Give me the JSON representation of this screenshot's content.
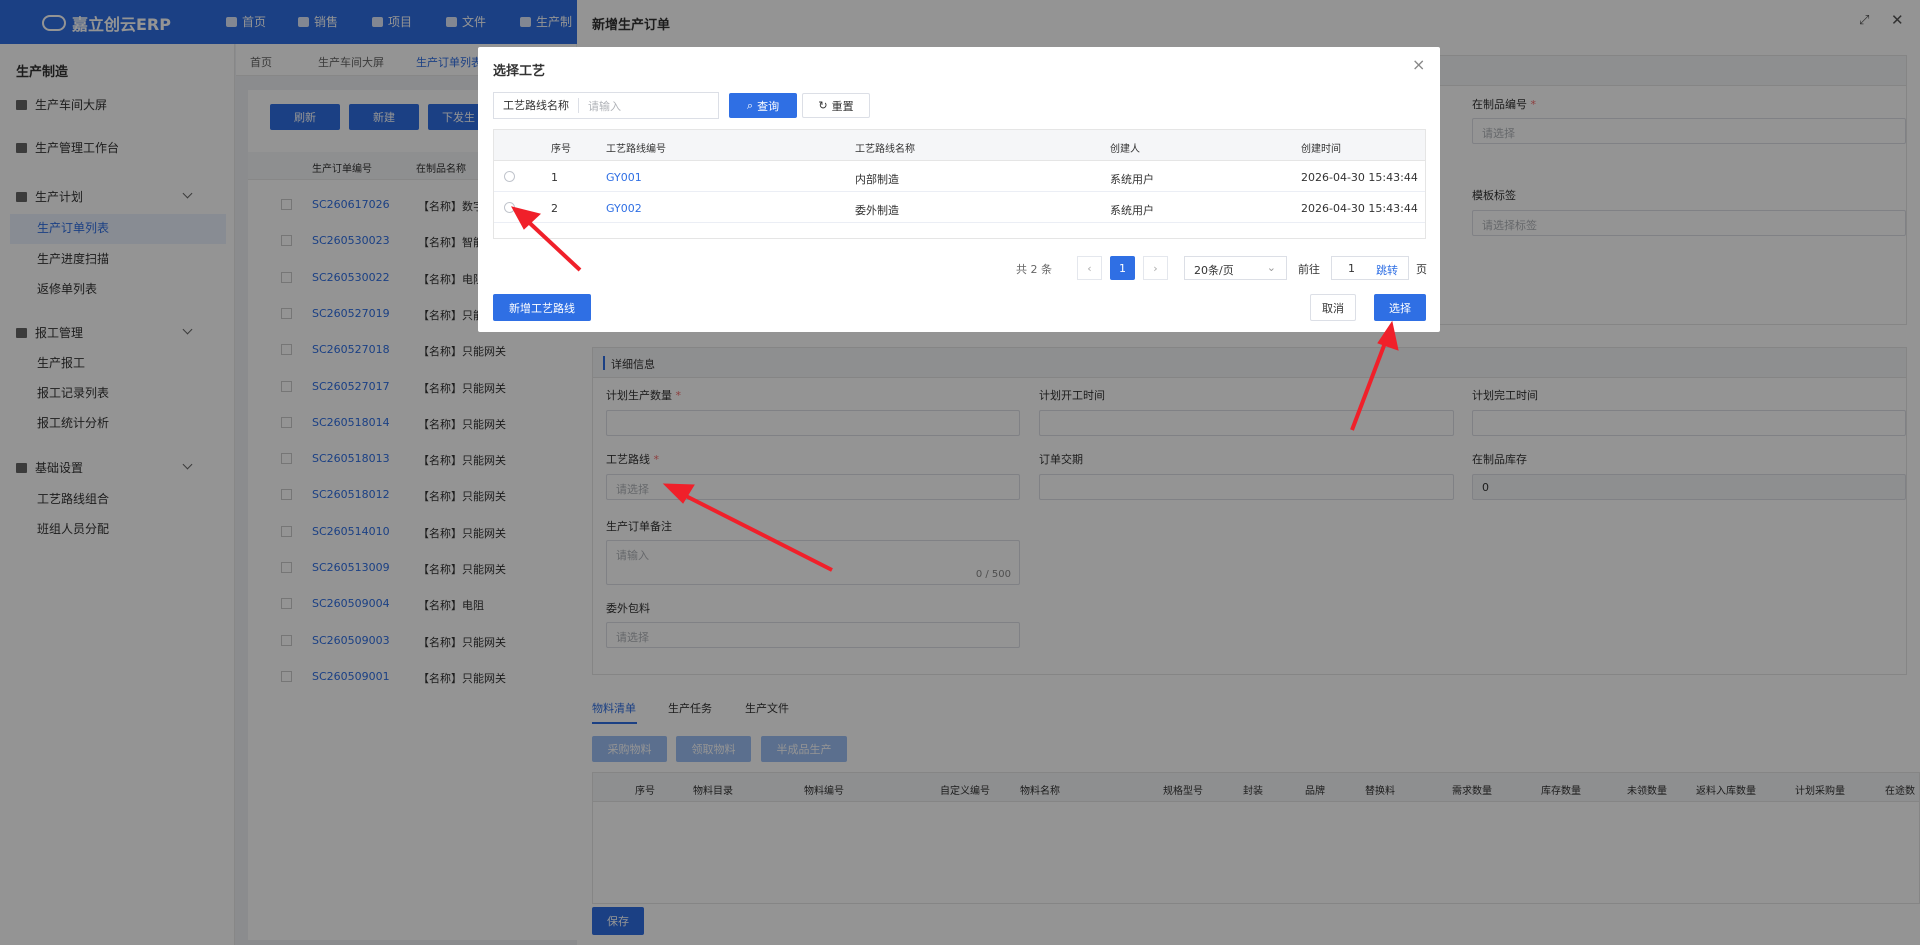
{
  "topbar": {
    "logo": "嘉立创云ERP",
    "nav": [
      "首页",
      "销售",
      "项目",
      "文件",
      "生产制"
    ]
  },
  "sidebar": {
    "title": "生产制造",
    "items": [
      {
        "label": "生产车间大屏"
      },
      {
        "label": "生产管理工作台"
      },
      {
        "label": "生产计划",
        "children": [
          "生产订单列表",
          "生产进度扫描",
          "返修单列表"
        ]
      },
      {
        "label": "报工管理",
        "children": [
          "生产报工",
          "报工记录列表",
          "报工统计分析"
        ]
      },
      {
        "label": "基础设置",
        "children": [
          "工艺路线组合",
          "班组人员分配"
        ]
      }
    ]
  },
  "breadcrumb": [
    "首页",
    "生产车间大屏",
    "生产订单列表"
  ],
  "list": {
    "buttons": {
      "refresh": "刷新",
      "new": "新建",
      "issue": "下发生"
    },
    "columns": [
      "生产订单编号",
      "在制品名称"
    ],
    "rows": [
      {
        "code": "SC260617026",
        "name": "【名称】数字"
      },
      {
        "code": "SC260530023",
        "name": "【名称】智能"
      },
      {
        "code": "SC260530022",
        "name": "【名称】电阻"
      },
      {
        "code": "SC260527019",
        "name": "【名称】只能"
      },
      {
        "code": "SC260527018",
        "name": "【名称】只能网关"
      },
      {
        "code": "SC260527017",
        "name": "【名称】只能网关"
      },
      {
        "code": "SC260518014",
        "name": "【名称】只能网关"
      },
      {
        "code": "SC260518013",
        "name": "【名称】只能网关"
      },
      {
        "code": "SC260518012",
        "name": "【名称】只能网关"
      },
      {
        "code": "SC260514010",
        "name": "【名称】只能网关"
      },
      {
        "code": "SC260513009",
        "name": "【名称】只能网关"
      },
      {
        "code": "SC260509004",
        "name": "【名称】电阻"
      },
      {
        "code": "SC260509003",
        "name": "【名称】只能网关"
      },
      {
        "code": "SC260509001",
        "name": "【名称】只能网关"
      }
    ]
  },
  "drawer": {
    "title": "新增生产订单",
    "basic": {
      "wip_code_label": "在制品编号",
      "wip_code_placeholder": "请选择",
      "template_label": "模板标签",
      "template_placeholder": "请选择标签"
    },
    "detail": {
      "section_title": "详细信息",
      "plan_qty_label": "计划生产数量",
      "plan_start_label": "计划开工时间",
      "plan_end_label": "计划完工时间",
      "route_label": "工艺路线",
      "route_placeholder": "请选择",
      "delivery_label": "订单交期",
      "wip_stock_label": "在制品库存",
      "wip_stock_value": "0",
      "remark_label": "生产订单备注",
      "remark_placeholder": "请输入",
      "remark_count": "0 / 500",
      "outsource_label": "委外包料",
      "outsource_placeholder": "请选择"
    },
    "tabs": [
      "物料清单",
      "生产任务",
      "生产文件"
    ],
    "bom_buttons": [
      "采购物料",
      "领取物料",
      "半成品生产"
    ],
    "bom_columns": [
      "序号",
      "物料目录",
      "物料编号",
      "自定义编号",
      "物料名称",
      "规格型号",
      "封装",
      "品牌",
      "替换料",
      "需求数量",
      "库存数量",
      "未领数量",
      "返料入库数量",
      "计划采购量",
      "在途数"
    ],
    "save": "保存"
  },
  "modal": {
    "title": "选择工艺",
    "search_label": "工艺路线名称",
    "search_placeholder": "请输入",
    "query": "查询",
    "reset": "重置",
    "columns": [
      "序号",
      "工艺路线编号",
      "工艺路线名称",
      "创建人",
      "创建时间"
    ],
    "rows": [
      {
        "no": "1",
        "code": "GY001",
        "name": "内部制造",
        "creator": "系统用户",
        "time": "2026-04-30 15:43:44"
      },
      {
        "no": "2",
        "code": "GY002",
        "name": "委外制造",
        "creator": "系统用户",
        "time": "2026-04-30 15:43:44"
      }
    ],
    "pagination": {
      "total": "共 2 条",
      "current": "1",
      "page_size": "20条/页",
      "goto": "前往",
      "goto_value": "1",
      "jump": "跳转",
      "page": "页"
    },
    "add_route": "新增工艺路线",
    "cancel": "取消",
    "select": "选择"
  },
  "colors": {
    "accent": "#2f6fe4",
    "arrow": "#f0202a"
  }
}
